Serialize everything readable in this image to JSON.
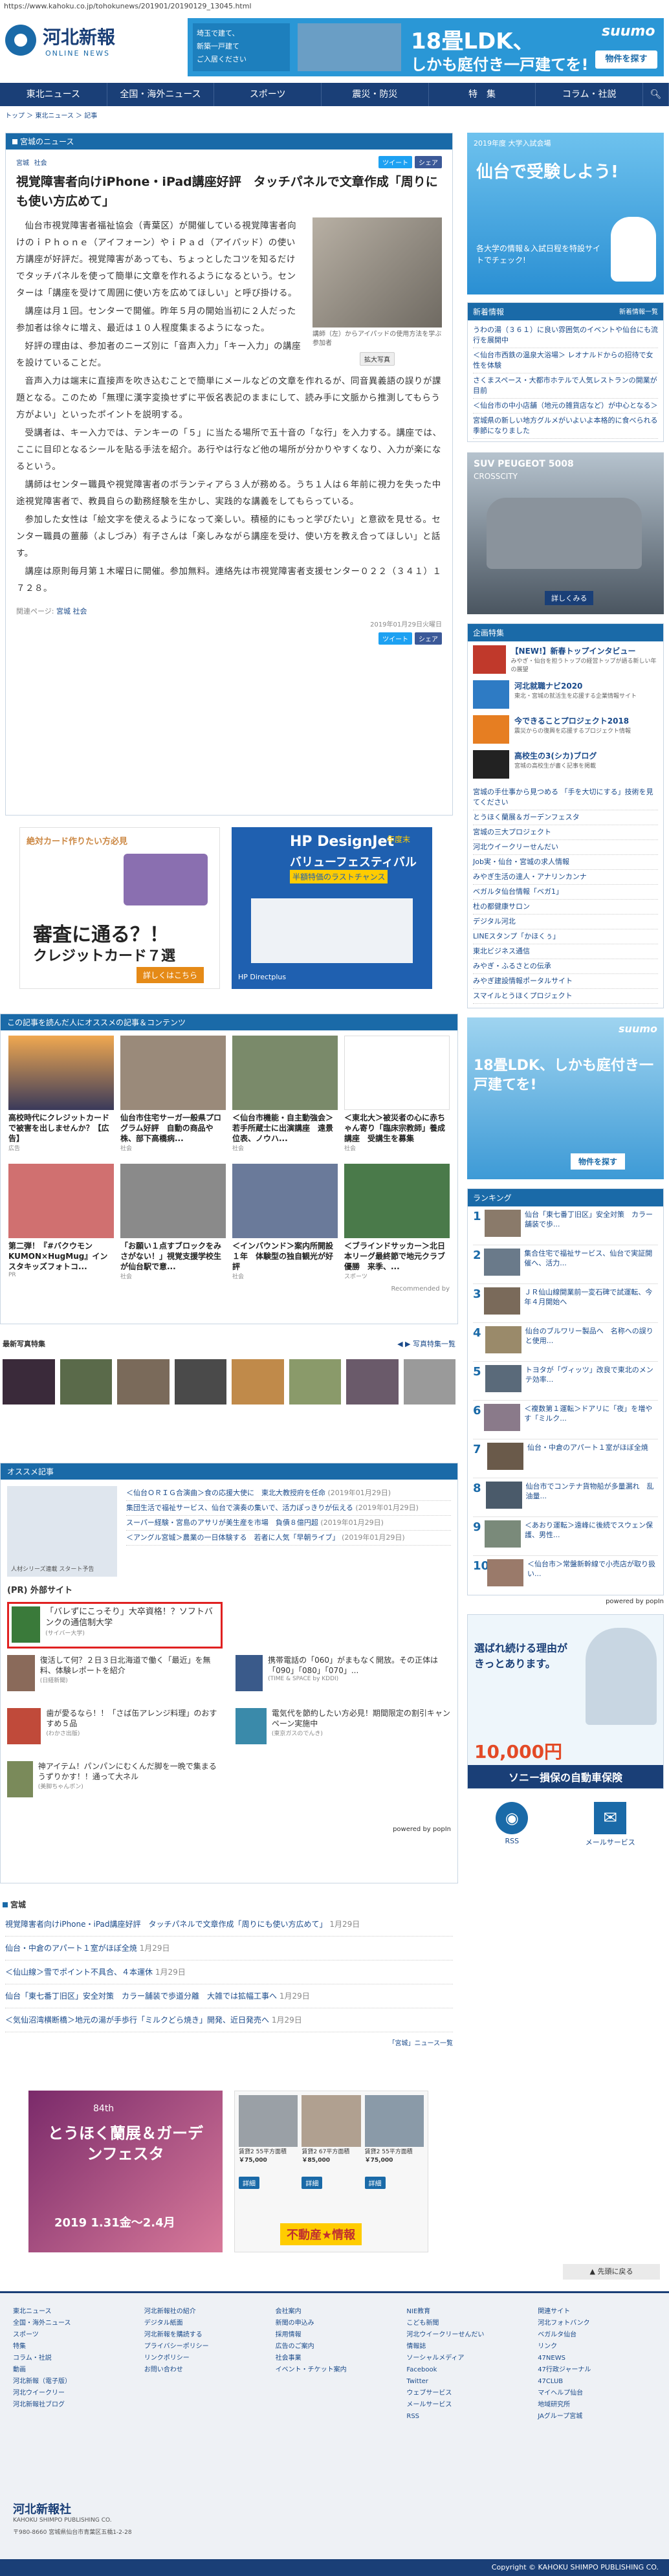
{
  "url": "https://www.kahoku.co.jp/tohokunews/201901/20190129_13045.html",
  "header": {
    "logo_title": "河北新報",
    "logo_sub": "ONLINE NEWS",
    "ad_top": {
      "left_text_1": "埼玉で建て、",
      "left_text_2": "新築一戸建て",
      "left_text_3": "ご入居ください",
      "main_1": "18畳LDK、",
      "main_2": "しかも庭付き一戸建てを!",
      "brand": "suumo",
      "cta": "物件を探す"
    },
    "nav": [
      "東北ニュース",
      "全国・海外ニュース",
      "スポーツ",
      "震災・防災",
      "特　集",
      "コラム・社説"
    ]
  },
  "breadcrumb": [
    "トップ",
    "東北ニュース",
    "記事"
  ],
  "section_label": "宮城のニュース",
  "article": {
    "tags": [
      "宮城",
      "社会"
    ],
    "tweet": "ツイート",
    "share": "シェア",
    "title": "視覚障害者向けiPhone・iPad講座好評　タッチパネルで文章作成「周りにも使い方広めて」",
    "photo_caption": "講師（左）からアイパッドの使用方法を学ぶ参加者",
    "enlarge": "拡大写真",
    "paragraphs": [
      "仙台市視覚障害者福祉協会（青葉区）が開催している視覚障害者向けのｉＰｈｏｎｅ（アイフォーン）やｉＰａｄ（アイパッド）の使い方講座が好評だ。視覚障害があっても、ちょっとしたコツを知るだけでタッチパネルを使って簡単に文章を作れるようになるという。センターは「講座を受けて周囲に使い方を広めてほしい」と呼び掛ける。",
      "講座は月１回。センターで開催。昨年５月の開始当初に２人だった参加者は徐々に増え、最近は１０人程度集まるようになった。",
      "好評の理由は、参加者のニーズ別に「音声入力」「キー入力」の講座を設けていることだ。",
      "音声入力は端末に直接声を吹き込むことで簡単にメールなどの文章を作れるが、同音異義語の誤りが課題となる。このため「無理に漢字変換せずに平仮名表記のままにして、読み手に文脈から推測してもらう方がよい」といったポイントを説明する。",
      "受講者は、キー入力では、テンキーの「５」に当たる場所で五十音の「な行」を入力する。講座では、ここに目印となるシールを貼る手法を紹介。あ行やは行など他の場所が分かりやすくなり、入力が楽になるという。",
      "講師はセンター職員や視覚障害者のボランティアら３人が務める。うち１人は６年前に視力を失った中途視覚障害者で、教員自らの勤務経験を生かし、実践的な講義をしてもらっている。",
      "参加した女性は「絵文字を使えるようになって楽しい。積極的にもっと学びたい」と意欲を見せる。センター職員の薑藤（よしづみ）有子さんは「楽しみながら講座を受け、使い方を教え合ってほしい」と話す。",
      "講座は原則毎月第１木曜日に開催。参加無料。連絡先は市視覚障害者支援センター０２２（３４１）１７２８。"
    ],
    "related_label": "関連ページ:",
    "related": [
      "宮城",
      "社会"
    ],
    "date": "2019年01月29日火曜日"
  },
  "ads_mid": {
    "credit_title": "審査に通る？！",
    "credit_sub": "クレジットカード７選",
    "credit_top": "絶対カード作りたい方必見",
    "credit_cta": "詳しくはこちら",
    "hp_title": "HP DesignJet",
    "hp_sub": "バリューフェスティバル",
    "hp_sub2": "半額特価のラストチャンス",
    "hp_date": "年度末",
    "hp_brand": "HP Directplus"
  },
  "recommend": {
    "header": "この記事を読んだ人にオススメの記事＆コンテンツ",
    "row1": [
      {
        "t": "高校時代にクレジットカードで被害を出しませんか？【広告】",
        "s": "広告"
      },
      {
        "t": "仙台市住宅サーガ一般県プログラム好評　自動の商品や株、部下高橋病...",
        "s": "社会"
      },
      {
        "t": "＜仙台市機能・自主動強会＞若手所蔵士に出演講座　遠景位表、ノウハ...",
        "s": "社会"
      },
      {
        "t": "＜東北大＞被災者の心に赤ちゃん寄り「臨床宗教師」養成講座　受講生を募集",
        "s": "社会"
      }
    ],
    "row2": [
      {
        "t": "第二弾！『#バクウモン KUMON×HugMug』インスタキッズフォトコ...",
        "s": "PR"
      },
      {
        "t": "「お願い１点すブロックをみさがない！」視覚支援学校生が仙台駅で意...",
        "s": "社会"
      },
      {
        "t": "＜インバウンド＞案内所開設１年　体験型の独自観光が好評",
        "s": "社会"
      },
      {
        "t": "＜ブラインドサッカー＞北日本リーグ最終節で地元クラブ優勝　来季、...",
        "s": "スポーツ"
      }
    ],
    "recommended_by": "Recommended by"
  },
  "photo_strip": {
    "label": "最新写真特集",
    "more": "写真特集一覧"
  },
  "osusume": {
    "header": "オススメ記事",
    "items": [
      {
        "t": "＜仙台ＯＲＩＧ合演曲＞食の応援大使に　東北大教授府を任命",
        "d": "(2019年01月29日)"
      },
      {
        "t": "集団生活で福祉サービス、仙台で演奏の集いで、活力ぽっきりが伝える",
        "d": "(2019年01月29日)"
      },
      {
        "t": "スーパー経験・宮島のアサリが美生産を市場　負債８億円超",
        "d": "(2019年01月29日)"
      },
      {
        "t": "＜アングル宮城＞農業の一日体験する　若者に人気「早朝ライブ」",
        "d": "(2019年01月29日)"
      }
    ],
    "thumb_caption": "人材シリーズ連載 スタート予告"
  },
  "pr": {
    "header": "(PR) 外部サイト",
    "items": [
      {
        "t": "「バレずにこっそり」大卒資格！？ソフトバンクの通信制大学",
        "s": "(サイバー大学)"
      },
      {
        "t": "復活して何？２日３日北海道で働く「最近」を無料、体験レポートを紹介",
        "s": "(日経新聞)"
      },
      {
        "t": "携帯電話の「060」がまもなく開放。その正体は「090」「080」「070」...",
        "s": "(TIME & SPACE by KDDI)"
      },
      {
        "t": "歯が愛るなら！！「さば缶アレンジ料理」のおすすめ５品",
        "s": "(わかさ出版)"
      },
      {
        "t": "電気代を節約したい方必見！期間限定の割引キャンペーン実施中",
        "s": "(東京ガスのでんき)"
      },
      {
        "t": "神アイテム！パンパンにむくんだ脚を一晩で集まるうずりかす！！通って大ネル",
        "s": "(美脚ちゃんポン)"
      }
    ],
    "powered": "powered by popIn"
  },
  "list_recent": {
    "header": "宮城",
    "items": [
      {
        "t": "視覚障害者向けiPhone・iPad講座好評　タッチパネルで文章作成「周りにも使い方広めて」",
        "d": "1月29日"
      },
      {
        "t": "仙台・中倉のアパート１室がほぼ全焼",
        "d": "1月29日"
      },
      {
        "t": "＜仙山線＞雪でポイント不具合、４本運休",
        "d": "1月29日"
      },
      {
        "t": "仙台「東七番丁旧区」安全対策　カラー舗装で歩道分離　大雑では拡幅工事へ",
        "d": "1月29日"
      },
      {
        "t": "＜気仙沼湾横断橋＞地元の湯が手歩行「ミルクどら焼き」開発、近日発売へ",
        "d": "1月29日"
      }
    ],
    "more": "「宮城」ニュース一覧"
  },
  "ads_bottom": {
    "fest_title": "とうほく蘭展＆ガーデンフェスタ",
    "fest_date": "2019 1.31金～2.4月",
    "fest_no": "84th",
    "homes": [
      {
        "p": "￥75,000",
        "t": "賃貸2 55平方面積"
      },
      {
        "p": "￥85,000",
        "t": "賃貸2 67平方面積"
      },
      {
        "p": "￥75,000",
        "t": "賃貸2 55平方面積"
      }
    ],
    "detail": "詳細",
    "estate": "不動産★情報"
  },
  "back_top": "先頭に戻る",
  "sidebar": {
    "banner1_title": "仙台で受験しよう!",
    "banner1_sub": "各大学の情報＆入試日程を特設サイトでチェック!",
    "banner1_head": "2019年度 大学入試会場",
    "news_header": "新着情報",
    "news_more": "新着情報一覧",
    "news": [
      "うわの湯（３６１）に良い雰囲気のイベントや仙台にも流行を展開中",
      "＜仙台市西鉄の温泉大浴場＞ レオナルドからの招待で女性を体験",
      "さくまスペース・大都市ホテルで人気レストランの開業が目前",
      "＜仙台市の中小店舗（地元の雑貨店など）が中心となる＞",
      "宮城県の新しい地方グルメがいよいよ本格的に食べられる季節になりました"
    ],
    "car_title": "SUV PEUGEOT 5008",
    "car_sub": "CROSSCITY",
    "car_cta": "詳しくみる",
    "kikaku_header": "企画特集",
    "kikaku": [
      {
        "t": "【NEW!】新春トップインタビュー",
        "s": "みやぎ・仙台を担うトップの経営トップが語る新しい年の展望"
      },
      {
        "t": "河北就職ナビ2020",
        "s": "東北・宮城の就活生を応援する企業情報サイト"
      },
      {
        "t": "今できることプロジェクト2018",
        "s": "震災からの復興を応援するプロジェクト情報"
      },
      {
        "t": "高校生の3(シカ)ブログ",
        "s": "宮城の高校生が書く記事を掲載"
      }
    ],
    "links": [
      "宮城の手仕事から見つめる 「手を大切にする」技術を見てください",
      "とうほく蘭展＆ガーデンフェスタ",
      "宮城の三大プロジェクト",
      "河北ウイークリーせんだい",
      "Job実・仙台・宮城の求人情報",
      "みやぎ生活の達人・アナリンカンナ",
      "ベガルタ仙台情報「ベガ1」",
      "杜の都健康サロン",
      "デジタル河北",
      "LINEスタンプ「かほくぅ」",
      "東北ビジネス通信",
      "みやぎ・ふるさとの伝承",
      "みやぎ建設情報ポータルサイト",
      "スマイルとうほくプロジェクト"
    ],
    "ad2_main": "18畳LDK、しかも庭付き一戸建てを!",
    "ad2_cta": "物件を探す",
    "ranking_header": "ランキング",
    "ranking": [
      "仙台「東七番丁旧区」安全対策　カラー舗装で歩...",
      "集合住宅で福祉サービス、仙台で実証開催へ、活力...",
      "ＪＲ仙山線開業前一変石碑で試運転、今年４月開始へ",
      "仙台のブルワリー製品へ　名称への誤りと使用...",
      "トヨタが「ヴィッツ」改良で東北のメンテ効率...",
      "＜複数第１運転＞ドアリに「夜」を増やす「ミルク...",
      "仙台・中倉のアパート１室がほぼ全焼",
      "仙台市でコンテナ貨物船が多量漏れ　乱油量...",
      "＜あおり運転＞遠峰に後続でスウェン保護、男性...",
      "＜仙台市＞常盤新幹線で小売店が取り扱い..."
    ],
    "popin": "powered by popIn",
    "sony_title": "選ばれ続ける理由が きっとあります。",
    "sony_amount": "10,000円",
    "sony_footer": "ソニー損保の自動車保険",
    "rss": "RSS",
    "mail": "メールサービス"
  },
  "footer": {
    "cols": [
      [
        "東北ニュース",
        "全国・海外ニュース",
        "スポーツ",
        "特集",
        "コラム・社説",
        "動画",
        "河北新報（電子版）",
        "河北ウイークリー",
        "河北新報社ブログ"
      ],
      [
        "河北新報社の紹介",
        "デジタル紙面",
        "河北新報を購読する",
        "プライバシーポリシー",
        "リンクポリシー",
        "お問い合わせ"
      ],
      [
        "会社案内",
        "新聞の申込み",
        "採用情報",
        "広告のご案内",
        "社会事業",
        "イベント・チケット案内"
      ],
      [
        "NIE教育",
        "こども新聞",
        "河北ウイークリーせんだい",
        "情報誌",
        "ソーシャルメディア",
        "Facebook",
        "Twitter",
        "ウェブサービス",
        "メールサービス",
        "RSS"
      ],
      [
        "関連サイト",
        "河北フォトバンク",
        "ベガルタ仙台",
        "リンク",
        "47NEWS",
        "47行政ジャーナル",
        "47CLUB",
        "マイヘルプ仙台",
        "地域研究所",
        "JAグループ宮城"
      ]
    ],
    "company": "河北新報社",
    "company_en": "KAHOKU SHIMPO PUBLISHING CO.",
    "address": "〒980-8660 宮城県仙台市青葉区五橋1-2-28",
    "copyright": "Copyright © KAHOKU SHIMPO PUBLISHING CO."
  }
}
